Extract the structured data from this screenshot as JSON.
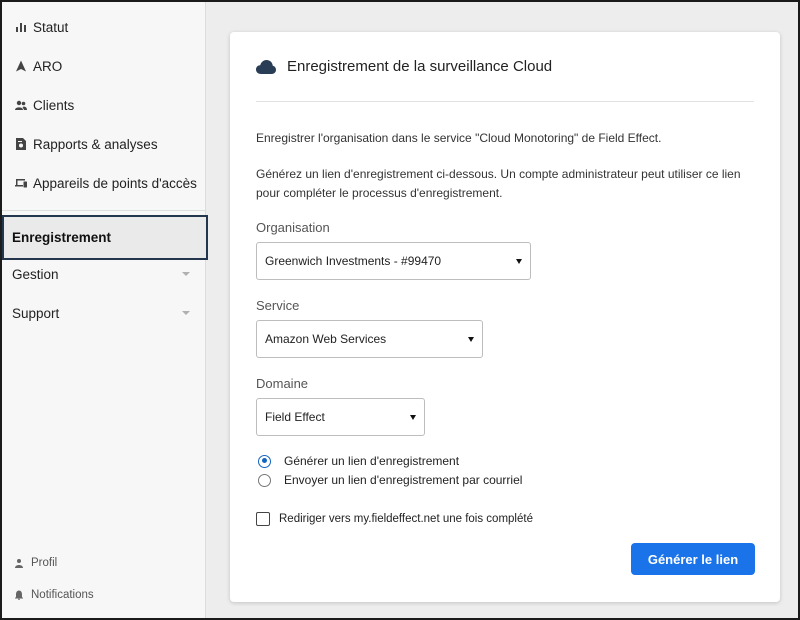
{
  "sidebar": {
    "items": [
      {
        "label": "Statut",
        "icon": "bar-chart-icon"
      },
      {
        "label": "ARO",
        "icon": "aro-icon"
      },
      {
        "label": "Clients",
        "icon": "people-icon"
      },
      {
        "label": "Rapports & analyses",
        "icon": "report-search-icon"
      },
      {
        "label": "Appareils de points d'accès",
        "icon": "devices-icon"
      }
    ],
    "active_label": "Enregistrement",
    "expandable": [
      {
        "label": "Gestion"
      },
      {
        "label": "Support"
      }
    ],
    "bottom": [
      {
        "label": "Profil",
        "icon": "person-icon"
      },
      {
        "label": "Notifications",
        "icon": "bell-icon"
      }
    ]
  },
  "card": {
    "title": "Enregistrement de la surveillance Cloud",
    "intro": "Enregistrer l'organisation dans le service \"Cloud Monotoring\" de Field Effect.",
    "instructions": "Générez un lien d'enregistrement ci-dessous. Un compte administrateur peut utiliser ce lien pour compléter le processus d'enregistrement.",
    "organisation": {
      "label": "Organisation",
      "value": "Greenwich Investments - #99470"
    },
    "service": {
      "label": "Service",
      "value": "Amazon Web Services"
    },
    "domaine": {
      "label": "Domaine",
      "value": "Field Effect"
    },
    "radio_options": [
      {
        "label": "Générer un lien d'enregistrement",
        "checked": true
      },
      {
        "label": "Envoyer un lien d'enregistrement par courriel",
        "checked": false
      }
    ],
    "redirect_checkbox": {
      "label": "Rediriger vers my.fieldeffect.net une fois complété",
      "checked": false
    },
    "generate_button": "Générer le lien"
  },
  "colors": {
    "primary": "#1a73e8",
    "active_border": "#24364e",
    "cloud_icon": "#2a3d56"
  }
}
